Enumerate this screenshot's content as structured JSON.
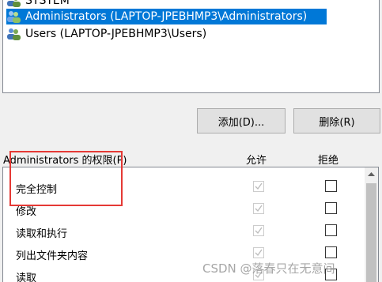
{
  "users_list": {
    "items": [
      {
        "label": "SYSTEM",
        "selected": false,
        "icon": "user-group-icon"
      },
      {
        "label": "Administrators (LAPTOP-JPEBHMP3\\Administrators)",
        "selected": true,
        "icon": "user-group-icon"
      },
      {
        "label": "Users (LAPTOP-JPEBHMP3\\Users)",
        "selected": false,
        "icon": "user-group-icon"
      }
    ]
  },
  "buttons": {
    "add": "添加(D)...",
    "remove": "删除(R)"
  },
  "permissions": {
    "title": "Administrators 的权限(P)",
    "allow_header": "允许",
    "deny_header": "拒绝",
    "rows": [
      {
        "name": "完全控制",
        "allow": true,
        "deny": false
      },
      {
        "name": "修改",
        "allow": true,
        "deny": false
      },
      {
        "name": "读取和执行",
        "allow": true,
        "deny": false
      },
      {
        "name": "列出文件夹内容",
        "allow": true,
        "deny": false
      },
      {
        "name": "读取",
        "allow": true,
        "deny": false
      }
    ]
  },
  "watermark": "CSDN @落春只在无意间",
  "colors": {
    "selection": "#0078d7",
    "highlight_box": "#e53935"
  }
}
